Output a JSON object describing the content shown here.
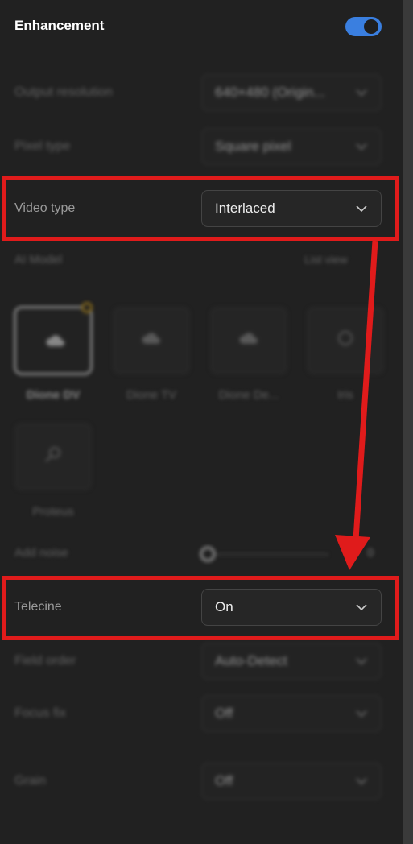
{
  "header": {
    "title": "Enhancement",
    "toggle_on": true,
    "accent_color": "#3a7fe0"
  },
  "settings": {
    "output_resolution": {
      "label": "Output resolution",
      "value": "640×480 (Origin..."
    },
    "pixel_type": {
      "label": "Pixel type",
      "value": "Square pixel"
    },
    "video_type": {
      "label": "Video type",
      "value": "Interlaced"
    },
    "telecine": {
      "label": "Telecine",
      "value": "On"
    },
    "field_order": {
      "label": "Field order",
      "value": "Auto-Detect"
    },
    "focus_fix": {
      "label": "Focus fix",
      "value": "Off"
    },
    "grain": {
      "label": "Grain",
      "value": "Off"
    }
  },
  "ai_model": {
    "label": "AI Model",
    "list_view": "List view",
    "models": [
      {
        "name": "Dione DV",
        "icon": "cloud-icon"
      },
      {
        "name": "Dione TV",
        "icon": "cloud-icon"
      },
      {
        "name": "Dione De...",
        "icon": "cloud-icon"
      },
      {
        "name": "Iris",
        "icon": "face-icon"
      },
      {
        "name": "Proteus",
        "icon": "magnifier-icon"
      }
    ]
  },
  "add_noise": {
    "label": "Add noise",
    "value": "0"
  },
  "annotation": {
    "highlight_color": "#e01b1b"
  }
}
